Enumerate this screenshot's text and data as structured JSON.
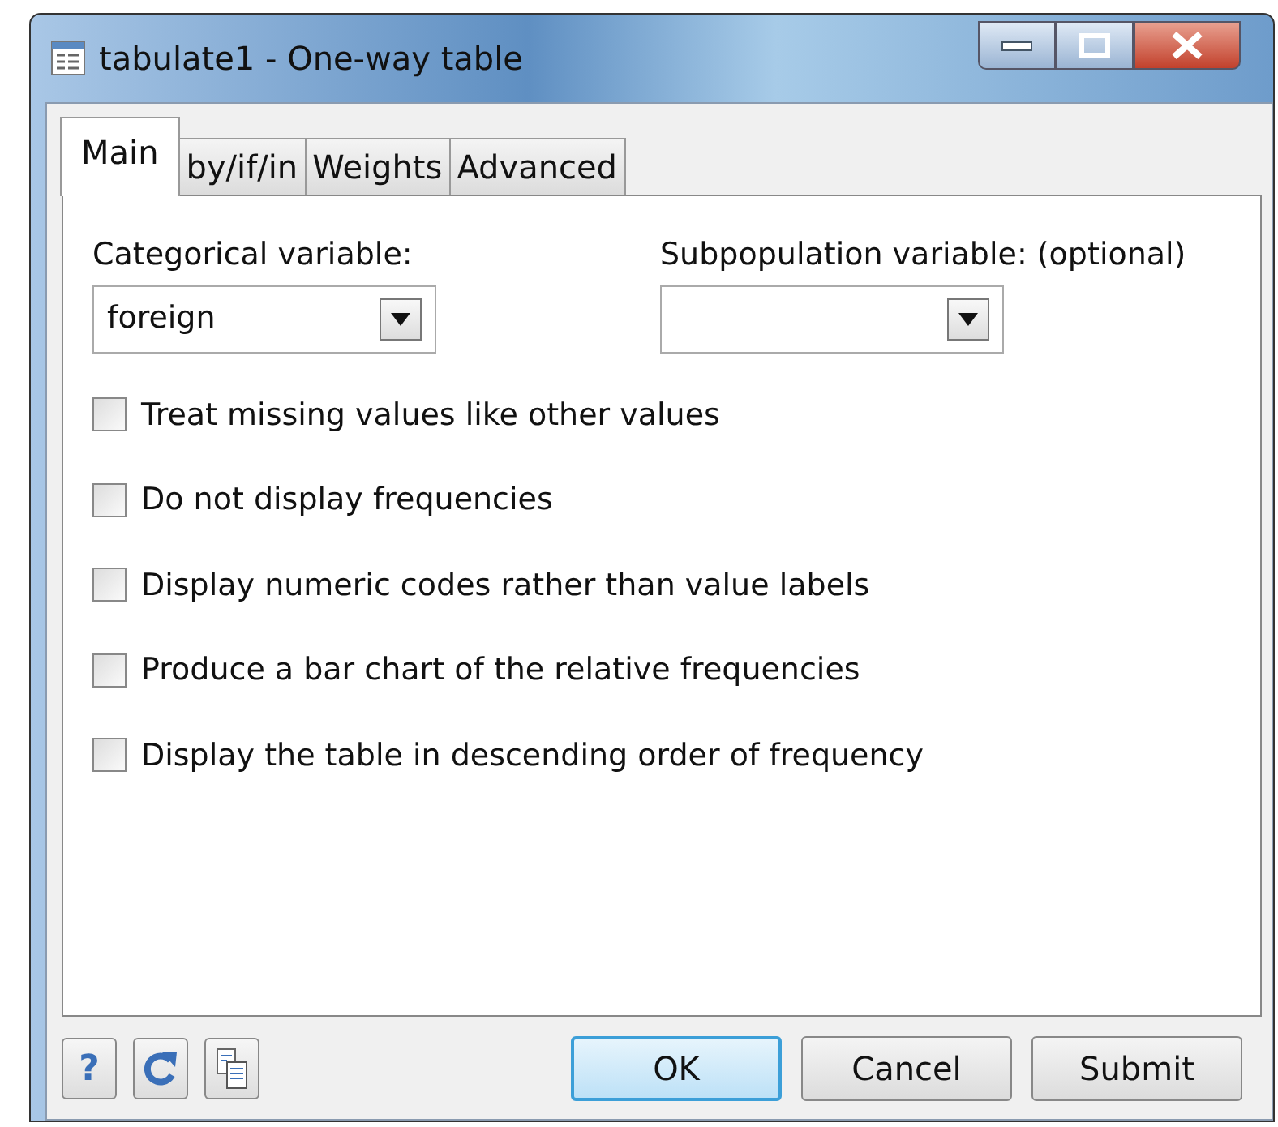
{
  "window": {
    "title": "tabulate1 - One-way table"
  },
  "tabs": [
    {
      "label": "Main",
      "selected": true
    },
    {
      "label": "by/if/in",
      "selected": false
    },
    {
      "label": "Weights",
      "selected": false
    },
    {
      "label": "Advanced",
      "selected": false
    }
  ],
  "fields": [
    {
      "label": "Categorical variable:",
      "value": "foreign"
    },
    {
      "label": "Subpopulation variable: (optional)"
    }
  ],
  "options": [
    {
      "label": "Treat missing values like other values",
      "checked": false
    },
    {
      "label": "Do not display frequencies",
      "checked": false
    },
    {
      "label": "Display numeric codes rather than value labels",
      "checked": false
    },
    {
      "label": "Produce a bar chart of the relative frequencies",
      "checked": false
    },
    {
      "label": "Display the table in descending order of frequency",
      "checked": false
    }
  ],
  "help_button": "?",
  "buttons": [
    {
      "label": "OK",
      "default": true
    },
    {
      "label": "Cancel",
      "default": false
    },
    {
      "label": "Submit",
      "default": false
    }
  ]
}
